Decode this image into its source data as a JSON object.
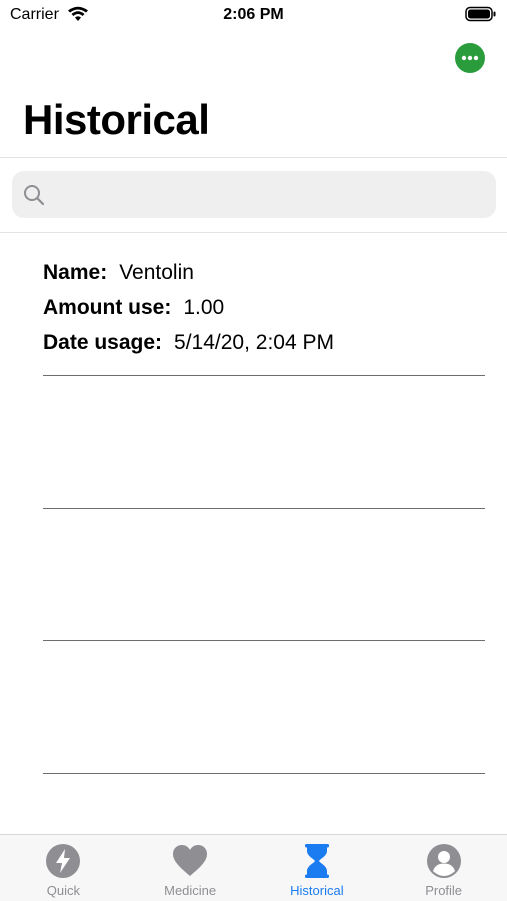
{
  "status_bar": {
    "carrier": "Carrier",
    "time": "2:06 PM"
  },
  "nav": {
    "more_icon": "ellipsis-circle-icon",
    "title": "Historical"
  },
  "search": {
    "placeholder": "",
    "value": ""
  },
  "records": [
    {
      "name_label": "Name:",
      "name": "Ventolin",
      "amount_label": "Amount use:",
      "amount": "1.00",
      "date_label": "Date usage:",
      "date": "5/14/20, 2:04 PM"
    }
  ],
  "tabs": [
    {
      "label": "Quick",
      "icon": "bolt-circle-icon",
      "active": false
    },
    {
      "label": "Medicine",
      "icon": "heart-icon",
      "active": false
    },
    {
      "label": "Historical",
      "icon": "hourglass-icon",
      "active": true
    },
    {
      "label": "Profile",
      "icon": "person-circle-icon",
      "active": false
    }
  ],
  "colors": {
    "accent": "#1b7cf2",
    "more_button": "#2b9c3c",
    "inactive_tab": "#8e8e93"
  }
}
